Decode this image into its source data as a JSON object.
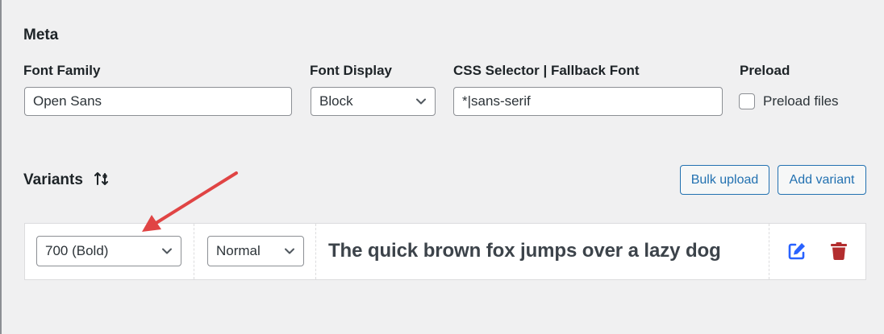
{
  "meta": {
    "title": "Meta",
    "font_family": {
      "label": "Font Family",
      "value": "Open Sans"
    },
    "font_display": {
      "label": "Font Display",
      "value": "Block"
    },
    "css_selector": {
      "label": "CSS Selector | Fallback Font",
      "value": "*|sans-serif"
    },
    "preload": {
      "label": "Preload",
      "checkbox_label": "Preload files",
      "checked": false
    }
  },
  "variants": {
    "title": "Variants",
    "bulk_upload_label": "Bulk upload",
    "add_variant_label": "Add variant",
    "rows": [
      {
        "weight": "700 (Bold)",
        "style": "Normal",
        "preview": "The quick brown fox jumps over a lazy dog"
      }
    ]
  },
  "colors": {
    "accent": "#2271b1",
    "edit_icon": "#2962ff",
    "delete_icon": "#b32d2e",
    "annotation_arrow": "#e04444"
  },
  "icons": [
    "chevron-down-icon",
    "sort-icon",
    "edit-icon",
    "trash-icon",
    "annotation-arrow"
  ]
}
